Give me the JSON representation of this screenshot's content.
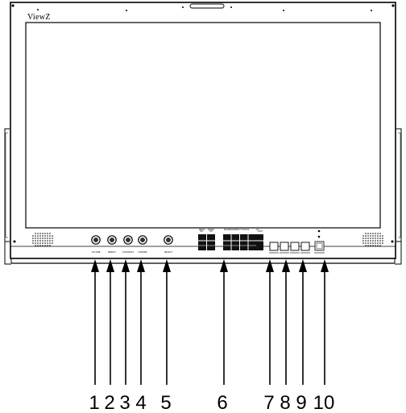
{
  "monitor": {
    "brand": "ViewZ",
    "knob_labels": [
      "VOLUME",
      "BRIGHT",
      "CONTRAST",
      "CHROMA",
      "SELECT"
    ],
    "button_group_labels": [
      "MENU",
      "MODE",
      "MARKER",
      "ASPECT",
      "FOCUS",
      "I/O"
    ]
  },
  "callouts": {
    "numbers": [
      "1",
      "2",
      "3",
      "4",
      "5",
      "6",
      "7",
      "8",
      "9",
      "10"
    ]
  }
}
